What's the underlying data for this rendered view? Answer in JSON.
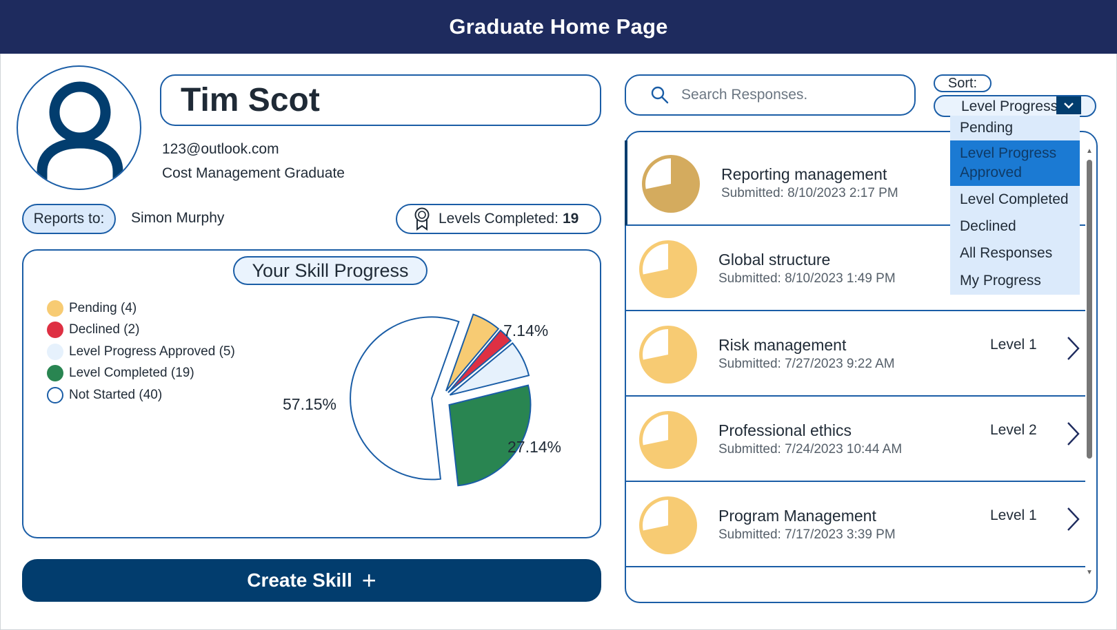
{
  "header": {
    "title": "Graduate Home Page"
  },
  "profile": {
    "name": "Tim Scot",
    "email": "123@outlook.com",
    "role": "Cost Management Graduate",
    "reports_label": "Reports to:",
    "reports_name": "Simon Murphy",
    "levels_label": "Levels Completed:",
    "levels_count": "19"
  },
  "progress": {
    "title": "Your Skill Progress",
    "legend": [
      {
        "label": "Pending (4)",
        "color": "#f7cb73"
      },
      {
        "label": "Declined (2)",
        "color": "#de3043"
      },
      {
        "label": "Level Progress Approved (5)",
        "color": "#e6f1fc"
      },
      {
        "label": "Level Completed (19)",
        "color": "#298551"
      },
      {
        "label": "Not Started (40)",
        "color": "#ffffff"
      }
    ]
  },
  "chart_data": {
    "type": "pie",
    "slices": [
      {
        "name": "Pending",
        "value": 4,
        "color": "#f7cb73"
      },
      {
        "name": "Declined",
        "value": 2,
        "color": "#de3043"
      },
      {
        "name": "Level Progress Approved",
        "value": 5,
        "color": "#e6f1fc"
      },
      {
        "name": "Level Completed",
        "value": 19,
        "color": "#298551"
      },
      {
        "name": "Not Started",
        "value": 40,
        "color": "#ffffff"
      }
    ],
    "data_labels": {
      "Level Progress Approved": "7.14%",
      "Level Completed": "27.14%",
      "Not Started": "57.15%"
    },
    "exploded": true
  },
  "actions": {
    "create_label": "Create Skill",
    "create_icon": "+"
  },
  "search": {
    "placeholder": "Search Responses."
  },
  "sort": {
    "label": "Sort:",
    "selected": "Level Progress Approved",
    "options": [
      "Pending",
      "Level Progress Approved",
      "Level Completed",
      "Declined",
      "All Responses",
      "My Progress"
    ],
    "active_index": 1
  },
  "responses": [
    {
      "title": "Reporting management",
      "submitted": "Submitted: 8/10/2023 2:17 PM",
      "level": "",
      "status_color": "#d4ab5e",
      "selected": true
    },
    {
      "title": "Global structure",
      "submitted": "Submitted: 8/10/2023 1:49 PM",
      "level": "",
      "status_color": "#f7cb73",
      "selected": false
    },
    {
      "title": "Risk management",
      "submitted": "Submitted: 7/27/2023 9:22 AM",
      "level": "Level 1",
      "status_color": "#f7cb73",
      "selected": false
    },
    {
      "title": "Professional ethics",
      "submitted": "Submitted: 7/24/2023 10:44 AM",
      "level": "Level 2",
      "status_color": "#f7cb73",
      "selected": false
    },
    {
      "title": "Program Management",
      "submitted": "Submitted: 7/17/2023 3:39 PM",
      "level": "Level 1",
      "status_color": "#f7cb73",
      "selected": false
    }
  ],
  "colors": {
    "header": "#1e2b5e",
    "accent": "#1a5da6",
    "button": "#023d6e"
  }
}
